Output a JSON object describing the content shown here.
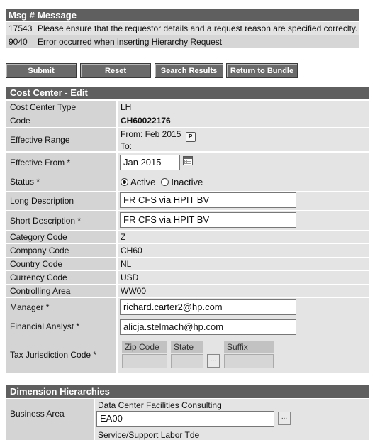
{
  "messages": {
    "headers": [
      "Msg #",
      "Message"
    ],
    "rows": [
      {
        "num": "17543",
        "text": "Please ensure that the requestor details and a request reason are specified correclty."
      },
      {
        "num": "9040",
        "text": "Error occurred when inserting Hierarchy Request"
      }
    ]
  },
  "buttons": {
    "submit": "Submit",
    "reset": "Reset",
    "search_results": "Search Results",
    "return_to_bundle": "Return to Bundle"
  },
  "form": {
    "title": "Cost Center - Edit",
    "cost_center_type": {
      "label": "Cost Center Type",
      "value": "LH"
    },
    "code": {
      "label": "Code",
      "value": "CH60022176"
    },
    "effective_range": {
      "label": "Effective Range",
      "from": "From: Feb 2015",
      "to": "To:",
      "icon": "pdf-icon"
    },
    "effective_from": {
      "label": "Effective From *",
      "value": "Jan 2015",
      "icon": "calendar-icon"
    },
    "status": {
      "label": "Status *",
      "options": [
        "Active",
        "Inactive"
      ],
      "selected": "Active"
    },
    "long_description": {
      "label": "Long Description",
      "value": "FR CFS via HPIT BV"
    },
    "short_description": {
      "label": "Short Description *",
      "value": "FR CFS via HPIT BV"
    },
    "category_code": {
      "label": "Category Code",
      "value": "Z"
    },
    "company_code": {
      "label": "Company Code",
      "value": "CH60"
    },
    "country_code": {
      "label": "Country Code",
      "value": "NL"
    },
    "currency_code": {
      "label": "Currency Code",
      "value": "USD"
    },
    "controlling_area": {
      "label": "Controlling Area",
      "value": "WW00"
    },
    "manager": {
      "label": "Manager *",
      "value": "richard.carter2@hp.com"
    },
    "financial_analyst": {
      "label": "Financial Analyst *",
      "value": "alicja.stelmach@hp.com"
    },
    "tax_jurisdiction": {
      "label": "Tax Jurisdiction Code *",
      "zip_label": "Zip Code",
      "state_label": "State",
      "suffix_label": "Suffix",
      "lookup": "..."
    }
  },
  "dimension": {
    "title": "Dimension Hierarchies",
    "business_area": {
      "label": "Business Area",
      "description": "Data Center Facilities Consulting",
      "value": "EA00",
      "lookup": "..."
    },
    "next_description": "Service/Support Labor Tde"
  }
}
